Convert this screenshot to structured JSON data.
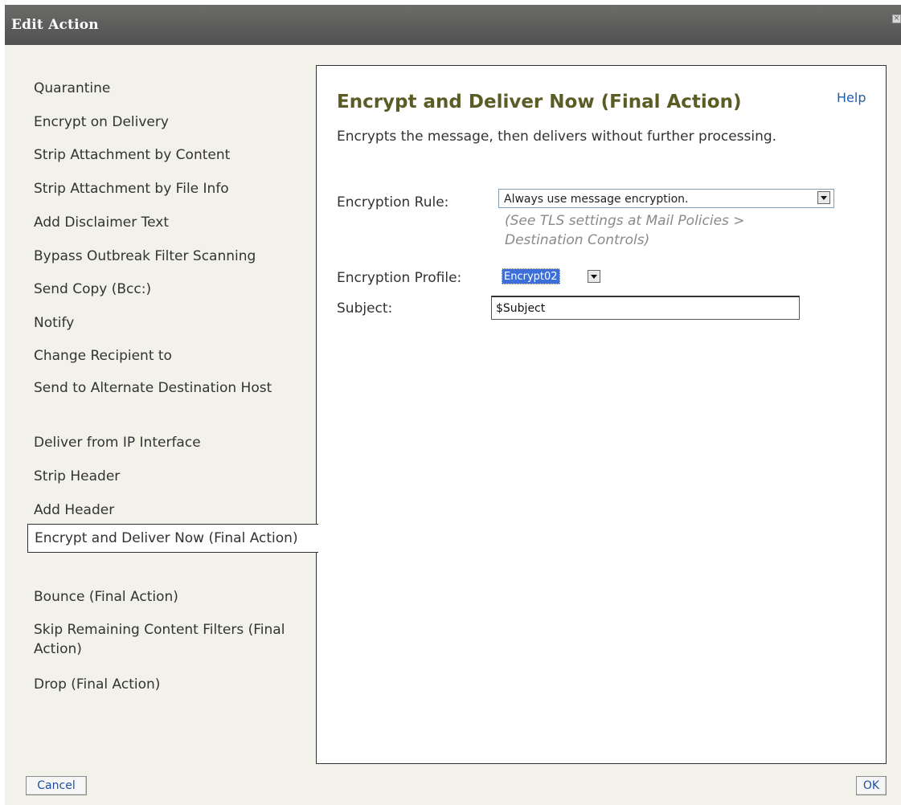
{
  "dialog": {
    "title": "Edit Action"
  },
  "actions": [
    {
      "label": "Quarantine"
    },
    {
      "label": "Encrypt on Delivery"
    },
    {
      "label": "Strip Attachment by Content"
    },
    {
      "label": "Strip Attachment by File Info"
    },
    {
      "label": "Add Disclaimer Text"
    },
    {
      "label": "Bypass Outbreak Filter Scanning"
    },
    {
      "label": "Send Copy (Bcc:)"
    },
    {
      "label": "Notify"
    },
    {
      "label": "Change Recipient to"
    },
    {
      "label": "Send to Alternate Destination Host"
    },
    {
      "label": "Deliver from IP Interface"
    },
    {
      "label": "Strip Header"
    },
    {
      "label": "Add Header"
    },
    {
      "label": "Encrypt and Deliver Now (Final Action)",
      "selected": true
    },
    {
      "label": "Bounce (Final Action)"
    },
    {
      "label": "Skip Remaining Content Filters (Final Action)"
    },
    {
      "label": "Drop (Final Action)"
    }
  ],
  "panel": {
    "title": "Encrypt and Deliver Now (Final Action)",
    "help_label": "Help",
    "description": "Encrypts the message, then delivers without further processing.",
    "encryption_rule": {
      "label": "Encryption Rule:",
      "value": "Always use message encryption.",
      "hint": "(See TLS settings at Mail Policies > Destination Controls)"
    },
    "encryption_profile": {
      "label": "Encryption Profile:",
      "value": "Encrypt02"
    },
    "subject": {
      "label": "Subject:",
      "value": "$Subject"
    }
  },
  "buttons": {
    "cancel": "Cancel",
    "ok": "OK"
  }
}
